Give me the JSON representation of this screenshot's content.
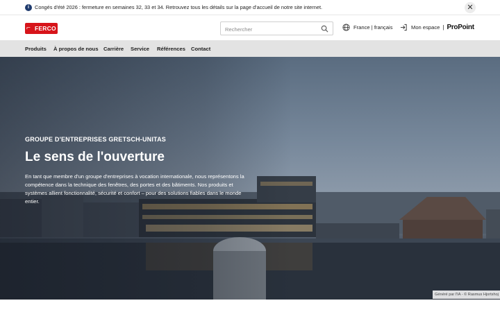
{
  "notice": {
    "text": "Congés d'été 2026 : fermeture en semaines 32, 33 et 34. Retrouvez tous les détails sur la page d'accueil de notre site internet.",
    "info_icon": "info-icon",
    "close_icon": "close-icon"
  },
  "header": {
    "logo_text": "FERCO",
    "search_placeholder": "Rechercher",
    "language_label": "France | français",
    "account_label": "Mon espace",
    "account_separator": "|",
    "brand_label": "ProPoint"
  },
  "nav": {
    "items": [
      {
        "label": "Produits"
      },
      {
        "label": "À propos de nous"
      },
      {
        "label": "Carrière"
      },
      {
        "label": "Service"
      },
      {
        "label": "Références"
      },
      {
        "label": "Contact"
      }
    ]
  },
  "hero": {
    "eyebrow": "GROUPE D'ENTREPRISES GRETSCH-UNITAS",
    "title": "Le sens de l'ouverture",
    "text": "En tant que membre d'un groupe d'entreprises à vocation internationale, nous représentons la compétence dans la technique des fenêtres, des portes et des bâtiments. Nos produits et systèmes allient fonctionnalité, sécurité et confort – pour des solutions fiables dans le monde entier.",
    "image_credit": "Généré par l'IA - © Rasmus Hjortshoj"
  },
  "colors": {
    "brand_red": "#d7141a",
    "nav_background": "#e3e3e3",
    "notice_icon": "#1f3b6e"
  }
}
